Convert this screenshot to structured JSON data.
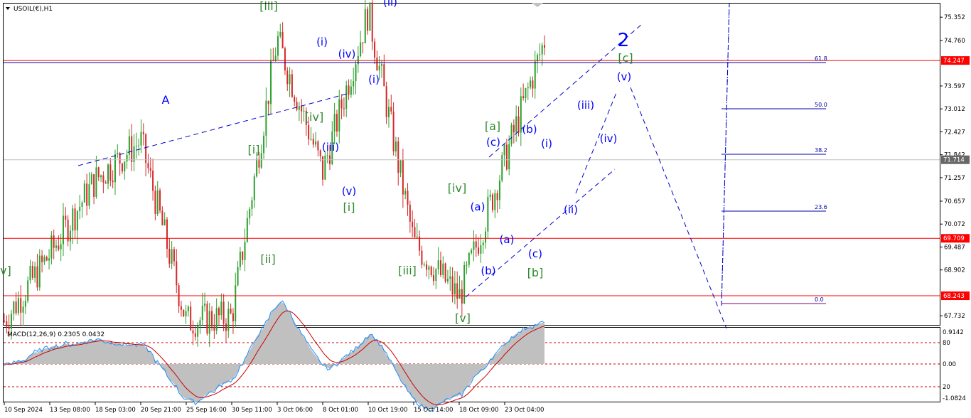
{
  "symbol_title": "USOIL(€),H1",
  "macd": {
    "label": "MACD(12,26,9) 0.2305 0.0432",
    "ticks": [
      "0.9142",
      "80",
      "0.00",
      "20",
      "-1.0824"
    ]
  },
  "price_axis": {
    "ticks": [
      "75.352",
      "74.760",
      "73.597",
      "73.012",
      "72.427",
      "71.842",
      "71.257",
      "70.657",
      "70.072",
      "69.487",
      "68.902",
      "67.732"
    ],
    "badges": [
      {
        "value": "74.247",
        "color": "#ff0000"
      },
      {
        "value": "71.714",
        "color": "#666666"
      },
      {
        "value": "69.709",
        "color": "#ff0000"
      },
      {
        "value": "68.243",
        "color": "#ff0000"
      }
    ]
  },
  "time_axis": [
    "10 Sep 2024",
    "13 Sep 08:00",
    "18 Sep 03:00",
    "20 Sep 21:00",
    "25 Sep 16:00",
    "30 Sep 11:00",
    "3 Oct 06:00",
    "8 Oct 01:00",
    "10 Oct 19:00",
    "15 Oct 14:00",
    "18 Oct 09:00",
    "23 Oct 04:00"
  ],
  "fib_levels": [
    "61.8",
    "50.0",
    "38.2",
    "23.6",
    "0.0"
  ],
  "wave_labels": [
    {
      "t": "A",
      "c": "#0000ff"
    },
    {
      "t": "2",
      "c": "#0000ff"
    },
    {
      "t": "[iii]",
      "c": "#2e8b2e"
    },
    {
      "t": "(ii)",
      "c": "#0000ff"
    },
    {
      "t": "(i)",
      "c": "#0000ff"
    },
    {
      "t": "(iv)",
      "c": "#0000ff"
    },
    {
      "t": "(i)",
      "c": "#0000ff"
    },
    {
      "t": "[iv]",
      "c": "#2e8b2e"
    },
    {
      "t": "(iii)",
      "c": "#0000ff"
    },
    {
      "t": "[i]",
      "c": "#2e8b2e"
    },
    {
      "t": "(v)",
      "c": "#0000ff"
    },
    {
      "t": "[i]",
      "c": "#2e8b2e"
    },
    {
      "t": "[ii]",
      "c": "#2e8b2e"
    },
    {
      "t": "[iv]",
      "c": "#2e8b2e"
    },
    {
      "t": "[iii]",
      "c": "#2e8b2e"
    },
    {
      "t": "(a)",
      "c": "#0000ff"
    },
    {
      "t": "(b)",
      "c": "#0000ff"
    },
    {
      "t": "[v]",
      "c": "#2e8b2e"
    },
    {
      "t": "[a]",
      "c": "#2e8b2e"
    },
    {
      "t": "(c)",
      "c": "#0000ff"
    },
    {
      "t": "(a)",
      "c": "#0000ff"
    },
    {
      "t": "(b)",
      "c": "#0000ff"
    },
    {
      "t": "(i)",
      "c": "#0000ff"
    },
    {
      "t": "(c)",
      "c": "#0000ff"
    },
    {
      "t": "[b]",
      "c": "#2e8b2e"
    },
    {
      "t": "(ii)",
      "c": "#0000ff"
    },
    {
      "t": "(iii)",
      "c": "#0000ff"
    },
    {
      "t": "(iv)",
      "c": "#0000ff"
    },
    {
      "t": "(v)",
      "c": "#0000ff"
    },
    {
      "t": "[c]",
      "c": "#2e8b2e"
    },
    {
      "t": "v]",
      "c": "#2e8b2e"
    }
  ],
  "chart_data": {
    "type": "candlestick",
    "symbol": "USOIL(€)",
    "timeframe": "H1",
    "ylim": [
      67.5,
      75.7
    ],
    "horizontal_levels": [
      74.247,
      69.709,
      68.243
    ],
    "current_price": 71.714,
    "path_key_points": [
      {
        "t": "10 Sep 2024",
        "price": 67.6
      },
      {
        "t": "13 Sep 08:00",
        "price": 69.3
      },
      {
        "t": "18 Sep 03:00",
        "price": 71.2
      },
      {
        "t": "20 Sep 21:00",
        "price": 72.2
      },
      {
        "t": "25 Sep 16:00",
        "price": 67.6
      },
      {
        "t": "30 Sep 11:00",
        "price": 67.7
      },
      {
        "t": "3 Oct 06:00",
        "price": 74.8
      },
      {
        "t": "8 Oct 01:00",
        "price": 71.4
      },
      {
        "t": "10 Oct 19:00",
        "price": 75.5
      },
      {
        "t": "15 Oct 14:00",
        "price": 69.6
      },
      {
        "t": "18 Oct 09:00",
        "price": 68.2
      },
      {
        "t": "23 Oct 04:00",
        "price": 71.7
      }
    ],
    "macd": {
      "params": "12,26,9",
      "main": 0.2305,
      "signal": 0.0432
    }
  }
}
